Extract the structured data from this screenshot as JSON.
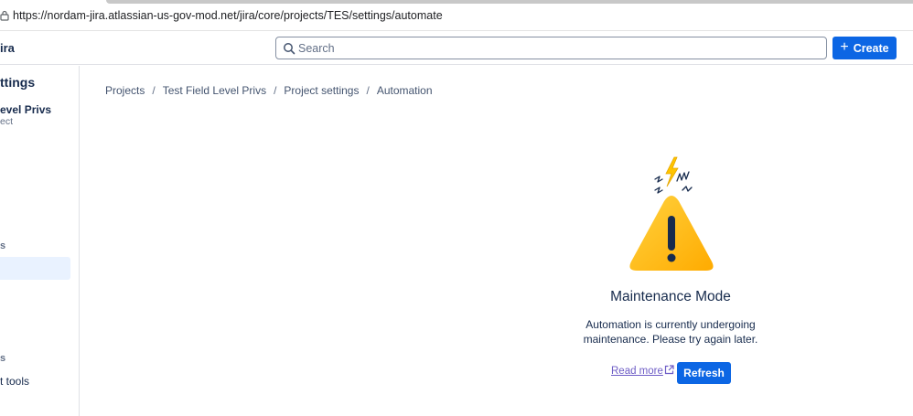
{
  "browser": {
    "url": "https://nordam-jira.atlassian-us-gov-mod.net/jira/core/projects/TES/settings/automate"
  },
  "topnav": {
    "product_name": "Jira",
    "product_visible": "ira",
    "search_placeholder": "Search",
    "create_label": "Create"
  },
  "sidebar": {
    "heading": "ttings",
    "project_name": "evel Privs",
    "project_type": "ect",
    "section_fragment_1": "s",
    "section_fragment_2": "s",
    "tools_item": "t tools"
  },
  "breadcrumbs": [
    "Projects",
    "Test Field Level Privs",
    "Project settings",
    "Automation"
  ],
  "maintenance": {
    "title": "Maintenance Mode",
    "description": "Automation is currently undergoing maintenance. Please try again later.",
    "read_more_label": "Read more",
    "refresh_label": "Refresh"
  },
  "colors": {
    "primary": "#0c66e4",
    "warning_yellow": "#ffc400",
    "link_purple": "#6e5dc6",
    "sidebar_active": "#e9f2ff"
  }
}
